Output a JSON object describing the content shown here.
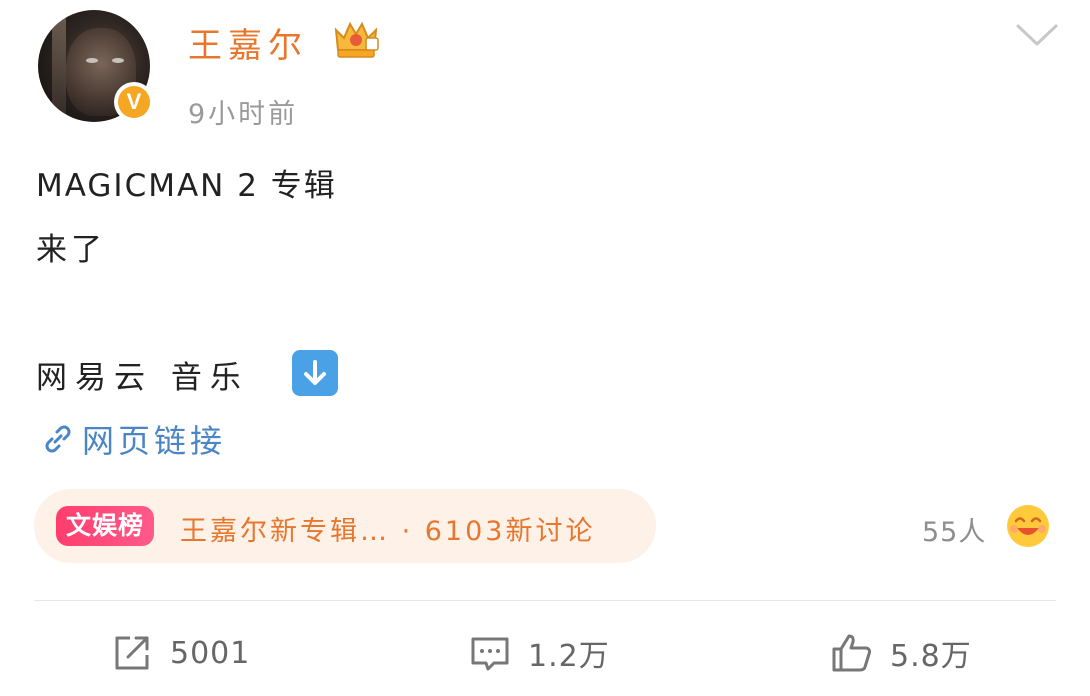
{
  "post": {
    "author": {
      "name": "王嘉尔",
      "verified_badge": "V",
      "avatar_icon": "avatar-photo",
      "level_icon": "crown-icon"
    },
    "timestamp": "9小时前",
    "content": {
      "line1": "MAGICMAN 2 专辑",
      "line2": "来了",
      "line3": "网易云 音乐",
      "arrow_icon": "down-arrow-icon"
    },
    "link": {
      "label": "网页链接",
      "icon": "link-icon"
    },
    "hot_topic": {
      "tag": "文娱榜",
      "text": "王嘉尔新专辑… · 6103新讨论"
    },
    "reactions": {
      "count": "55人",
      "emoji_icon": "laughing-face-icon"
    },
    "actions": {
      "repost": "5001",
      "comment": "1.2万",
      "like": "5.8万"
    }
  },
  "colors": {
    "username": "#e8772e",
    "link": "#4a86c5",
    "hot_tag": "#ff3d6e",
    "hot_bg": "#fdf1e8",
    "badge": "#f5a623"
  }
}
